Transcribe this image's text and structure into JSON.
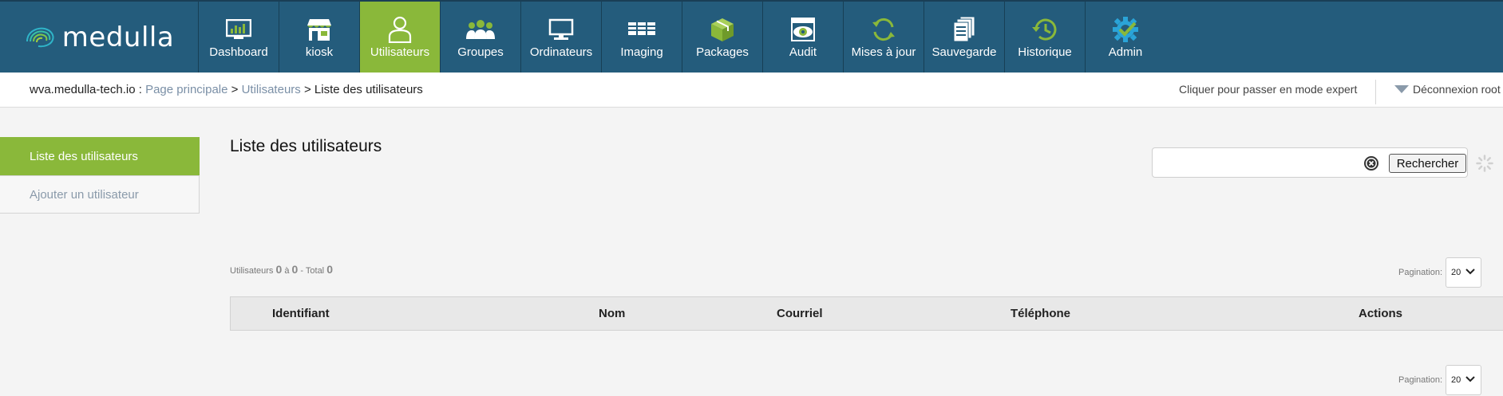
{
  "app": {
    "logo_text": "medulla"
  },
  "nav": {
    "items": [
      {
        "label": "Dashboard",
        "icon": "dashboard-icon"
      },
      {
        "label": "kiosk",
        "icon": "kiosk-icon"
      },
      {
        "label": "Utilisateurs",
        "icon": "user-icon",
        "active": true
      },
      {
        "label": "Groupes",
        "icon": "group-icon"
      },
      {
        "label": "Ordinateurs",
        "icon": "computer-icon"
      },
      {
        "label": "Imaging",
        "icon": "imaging-icon"
      },
      {
        "label": "Packages",
        "icon": "package-icon"
      },
      {
        "label": "Audit",
        "icon": "audit-icon"
      },
      {
        "label": "Mises à jour",
        "icon": "update-icon"
      },
      {
        "label": "Sauvegarde",
        "icon": "backup-icon"
      },
      {
        "label": "Historique",
        "icon": "history-icon"
      },
      {
        "label": "Admin",
        "icon": "admin-gear-icon"
      }
    ]
  },
  "breadcrumb": {
    "host": "wva.medulla-tech.io",
    "colon": " : ",
    "home": "Page principale",
    "sep": " > ",
    "section": "Utilisateurs",
    "current": "Liste des utilisateurs"
  },
  "header_right": {
    "expert_mode": "Cliquer pour passer en mode expert",
    "logout": "Déconnexion root"
  },
  "sidebar": {
    "items": [
      {
        "label": "Liste des utilisateurs",
        "active": true
      },
      {
        "label": "Ajouter un utilisateur",
        "active": false
      }
    ]
  },
  "main": {
    "title": "Liste des utilisateurs",
    "search": {
      "value": "",
      "button_label": "Rechercher"
    },
    "count": {
      "prefix": "Utilisateurs",
      "from": "0",
      "to_word": "à",
      "to": "0",
      "total_word": "- Total",
      "total": "0"
    },
    "pagination": {
      "label": "Pagination:",
      "value": "20"
    },
    "table": {
      "columns": [
        "Identifiant",
        "Nom",
        "Courriel",
        "Téléphone",
        "Actions"
      ],
      "rows": []
    }
  },
  "colors": {
    "nav_bg": "#245c7c",
    "accent_green": "#8ab83a"
  }
}
